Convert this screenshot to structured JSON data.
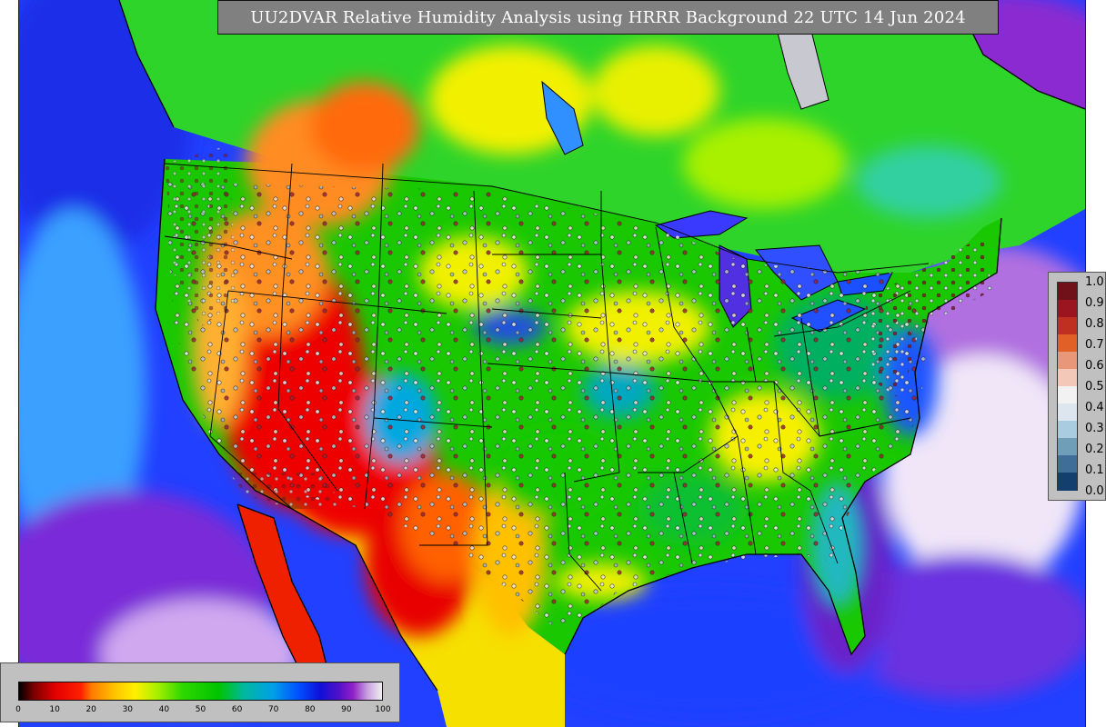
{
  "title": "UU2DVAR Relative Humidity Analysis using HRRR Background 22 UTC 14 Jun 2024",
  "colors": {
    "map_background": "#19c800",
    "ocean": "#1f3cff",
    "dry_red": "#ee0000",
    "orange": "#ff9a20",
    "yellow": "#f6f600",
    "green": "#17d41a",
    "cyan": "#10a8c8",
    "purple": "#9a28d0",
    "gray_panel": "#c0c0c0",
    "title_bg": "#808080"
  },
  "rh_colorbar": {
    "ticks": [
      "0",
      "10",
      "20",
      "30",
      "40",
      "50",
      "60",
      "70",
      "80",
      "90",
      "100"
    ],
    "range": [
      0,
      100
    ],
    "stops": [
      {
        "value": 0,
        "color": "#000000"
      },
      {
        "value": 4,
        "color": "#7a0000"
      },
      {
        "value": 10,
        "color": "#e40000"
      },
      {
        "value": 17,
        "color": "#ff2000"
      },
      {
        "value": 20,
        "color": "#ff7a00"
      },
      {
        "value": 26,
        "color": "#ffc000"
      },
      {
        "value": 32,
        "color": "#fff000"
      },
      {
        "value": 38,
        "color": "#a8f000"
      },
      {
        "value": 45,
        "color": "#2ed800"
      },
      {
        "value": 55,
        "color": "#00c400"
      },
      {
        "value": 62,
        "color": "#00b8a0"
      },
      {
        "value": 70,
        "color": "#00a0e8"
      },
      {
        "value": 77,
        "color": "#0050ff"
      },
      {
        "value": 83,
        "color": "#1010d8"
      },
      {
        "value": 88,
        "color": "#5010c8"
      },
      {
        "value": 92,
        "color": "#9020c8"
      },
      {
        "value": 96,
        "color": "#c8a0e0"
      },
      {
        "value": 100,
        "color": "#f0f0f0"
      }
    ]
  },
  "obs_legend": {
    "ticks": [
      "1.0",
      "0.9",
      "0.8",
      "0.7",
      "0.6",
      "0.5",
      "0.4",
      "0.3",
      "0.2",
      "0.1",
      "0.0"
    ],
    "colors": [
      "#701018",
      "#9a1520",
      "#c03020",
      "#e06028",
      "#e89878",
      "#f4c8b8",
      "#f2f2f2",
      "#dde6ee",
      "#a9cce0",
      "#6f9fb8",
      "#3f6f98",
      "#123f6e"
    ]
  }
}
